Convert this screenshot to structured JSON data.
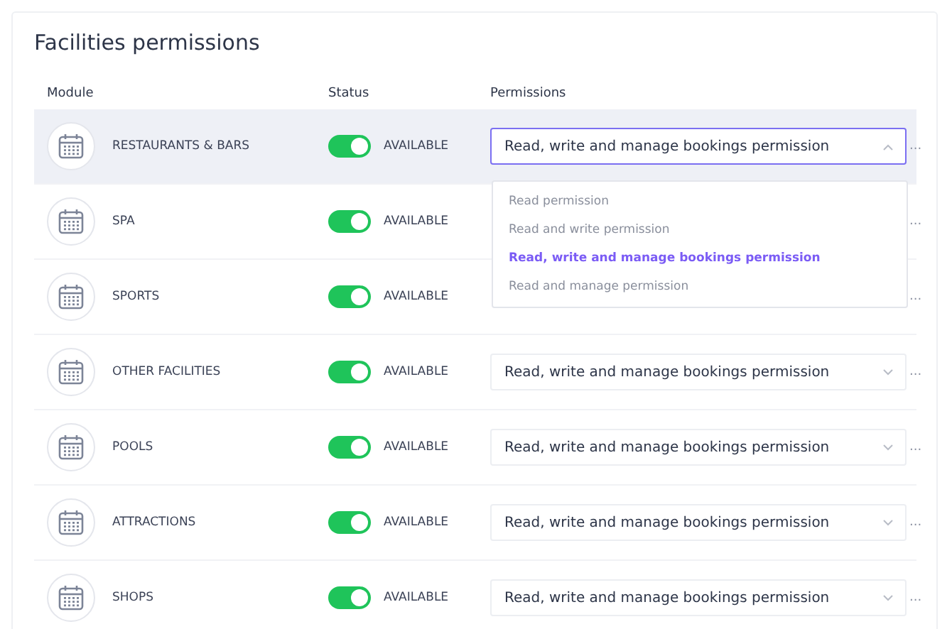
{
  "title": "Facilities permissions",
  "columns": [
    "Module",
    "Status",
    "Permissions"
  ],
  "rows": [
    {
      "module": "RESTAURANTS & BARS",
      "on": true,
      "status": "AVAILABLE",
      "permission": "Read, write and manage bookings permission",
      "open": true,
      "more": "..."
    },
    {
      "module": "SPA",
      "on": true,
      "status": "AVAILABLE",
      "more": "..."
    },
    {
      "module": "SPORTS",
      "on": true,
      "status": "AVAILABLE",
      "more": "..."
    },
    {
      "module": "OTHER FACILITIES",
      "on": true,
      "status": "AVAILABLE",
      "permission": "Read, write and manage bookings permission",
      "open": false,
      "more": "..."
    },
    {
      "module": "POOLS",
      "on": true,
      "status": "AVAILABLE",
      "permission": "Read, write and manage bookings permission",
      "open": false,
      "more": "..."
    },
    {
      "module": "ATTRACTIONS",
      "on": true,
      "status": "AVAILABLE",
      "permission": "Read, write and manage bookings permission",
      "open": false,
      "more": "..."
    },
    {
      "module": "SHOPS",
      "on": true,
      "status": "AVAILABLE",
      "permission": "Read, write and manage bookings permission",
      "open": false,
      "more": "..."
    }
  ],
  "dropdown": {
    "options": [
      {
        "label": "Read permission",
        "selected": false
      },
      {
        "label": "Read and write permission",
        "selected": false
      },
      {
        "label": "Read, write and manage bookings permission",
        "selected": true
      },
      {
        "label": "Read and manage permission",
        "selected": false
      }
    ]
  }
}
